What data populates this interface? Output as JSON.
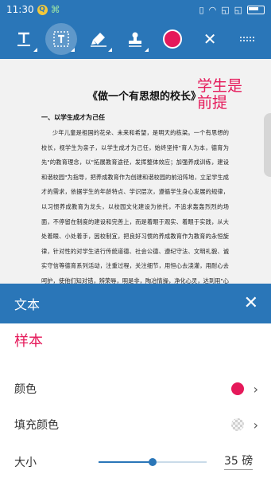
{
  "status_bar": {
    "time": "11:30",
    "badge_left": "Q",
    "badge_right": "⌘"
  },
  "toolbar": {
    "tools": [
      {
        "name": "text-tool-icon",
        "glyph": "T"
      },
      {
        "name": "typewriter-tool-icon",
        "glyph": "T"
      },
      {
        "name": "highlighter-tool-icon",
        "glyph": "✎"
      },
      {
        "name": "stamp-tool-icon",
        "glyph": "⬢"
      }
    ],
    "current_color": "#e5195a",
    "close_label": "✕",
    "more_label": "⠿"
  },
  "document": {
    "title": "《做一个有思想的校长》",
    "annotation": "学生是前提",
    "heading": "一、以学生成才为己任",
    "body": "少年儿童是祖国的花朵、未来和希望，是明天的栋梁。一个有思想的校长，视学生为亲子，以学生成才为己任，始终坚持\"育人为本，德育为先\"的教育理念，以\"拓展教育途径，发挥整体效应；加强养成训练，建设和谐校园\"为指导，把养成教育作为创建和谐校园的前沿阵地，立足学生成才的需求，依据学生的年龄特点、学识层次，遵循学生身心发展的规律，以习惯养成教育为龙头，以校园文化建设为依托，不追求轰轰烈烈的场面，不停留在制度的建设和完善上，而是着眼于观实、着眼于实践，从大处着眼、小处着手，因校制宜，把良好习惯的养成教育作为教育的永恒旋律，针对性的对学生进行传统道德、社会公德、遵纪守法、文明礼貌、诚实守信等德育系列活动，注重过程，关注细节，用恒心去浇灌，用耐心去呵护，使他们知对错，辨荣辱，明是非，陶冶情操，净化心灵，达到用\"心灵滋润心灵\"的教育境界，番然和谐的联系，启发有为的人生观、价值观，学会"
  },
  "sheet": {
    "title": "文本",
    "close_label": "✕",
    "sample_text": "样本",
    "rows": {
      "color_label": "颜色",
      "fill_label": "填充颜色",
      "size_label": "大小"
    },
    "text_color": "#e5195a",
    "size_value": "35 磅",
    "size_fraction": 0.5
  }
}
